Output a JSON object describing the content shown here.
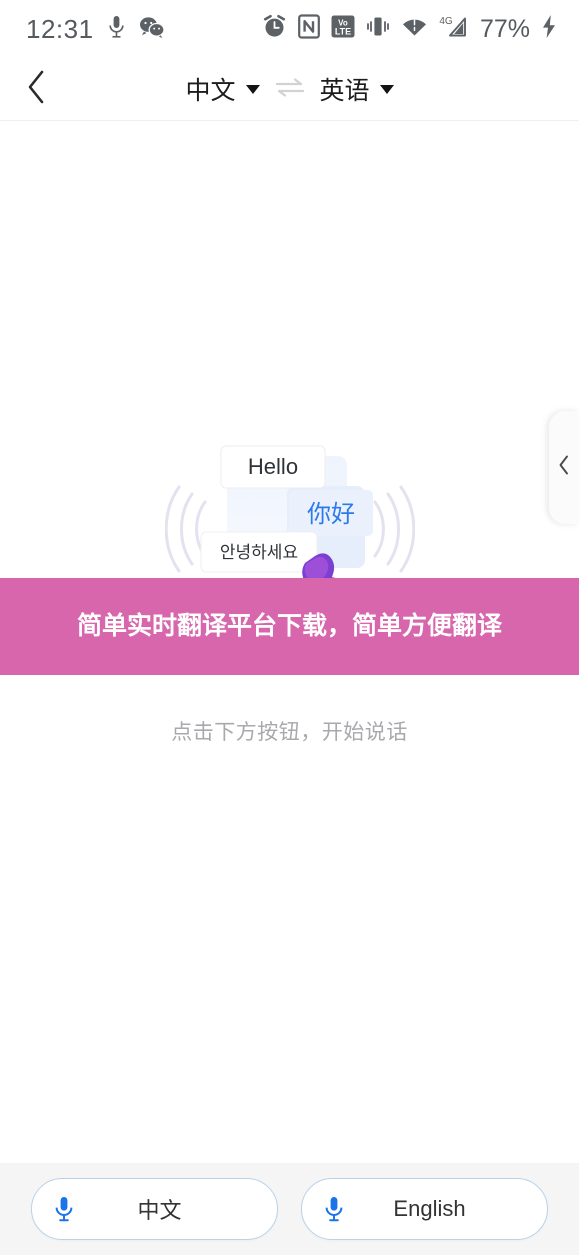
{
  "status_bar": {
    "time": "12:31",
    "battery": "77%",
    "left_icons": [
      "microphone-icon",
      "wechat-icon"
    ],
    "right_icons": [
      "alarm-icon",
      "nfc-icon",
      "volte-icon",
      "vibrate-icon",
      "wifi-icon",
      "4g-signal-icon",
      "charging-bolt-icon"
    ],
    "signal_label": "4G",
    "volte_top": "VoLTE",
    "text_color": "#555a5e"
  },
  "header": {
    "back_icon": "chevron-left-icon",
    "source_language": "中文",
    "swap_icon": "swap-horizontal-icon",
    "target_language": "英语",
    "dropdown_icon": "caret-down-icon"
  },
  "main": {
    "illustration": {
      "name": "translation-chat-illustration",
      "bubbles": [
        {
          "text": "Hello",
          "lang": "en"
        },
        {
          "text": "你好",
          "lang": "zh"
        },
        {
          "text": "안녕하세요",
          "lang": "ko"
        }
      ],
      "bubble_accent_color": "#2c7be8"
    },
    "hint": "点击下方按钮，开始说话",
    "side_handle_icon": "chevron-left-icon"
  },
  "ad_banner": {
    "text": "简单实时翻译平台下载，简单方便翻译",
    "background_color": "#d766ac",
    "text_color": "#ffffff"
  },
  "bottom_bar": {
    "background_color": "#f5f5f6",
    "buttons": [
      {
        "label": "中文",
        "icon": "microphone-icon",
        "icon_color": "#1a73e8"
      },
      {
        "label": "English",
        "icon": "microphone-icon",
        "icon_color": "#1a73e8"
      }
    ]
  }
}
